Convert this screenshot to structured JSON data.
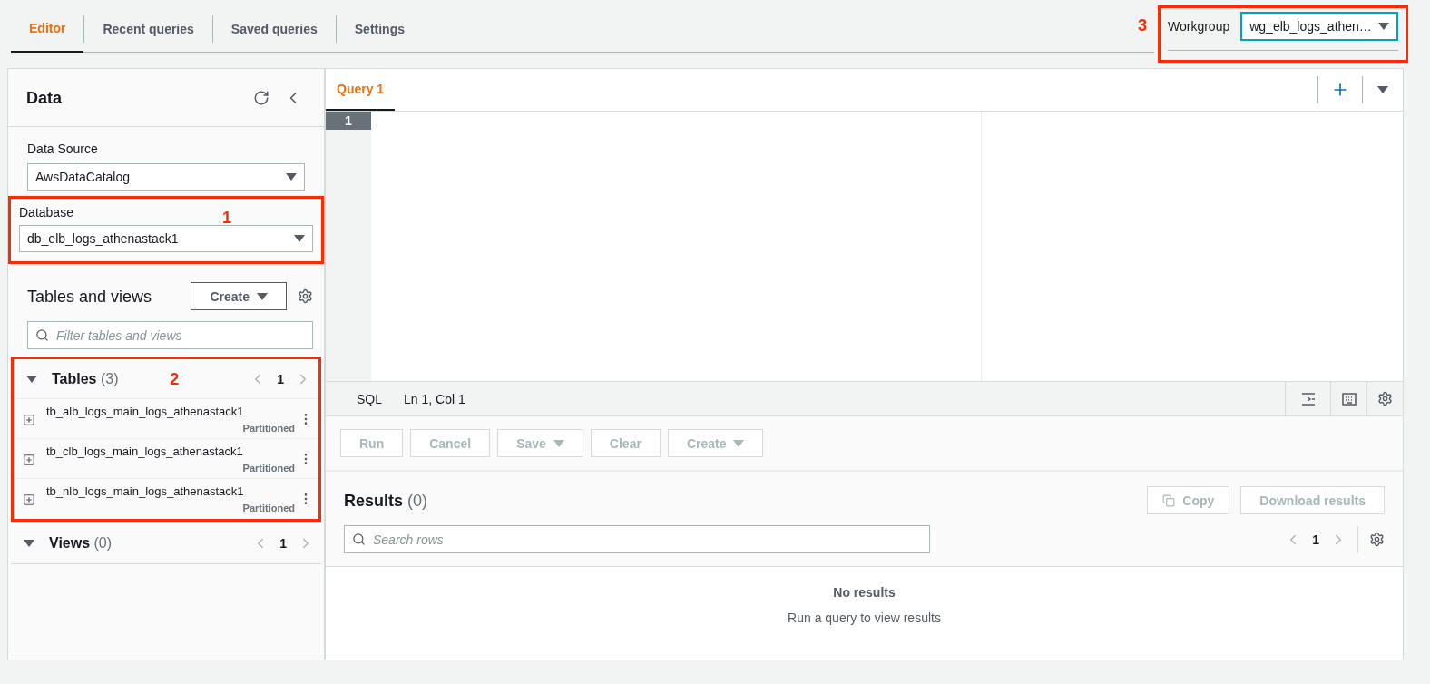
{
  "tabs": [
    {
      "label": "Editor",
      "selected": true
    },
    {
      "label": "Recent queries",
      "selected": false
    },
    {
      "label": "Saved queries",
      "selected": false
    },
    {
      "label": "Settings",
      "selected": false
    }
  ],
  "workgroup": {
    "label": "Workgroup",
    "value": "wg_elb_logs_athen…",
    "annotation": "3"
  },
  "data_panel": {
    "title": "Data",
    "data_source": {
      "label": "Data Source",
      "value": "AwsDataCatalog"
    },
    "database": {
      "label": "Database",
      "value": "db_elb_logs_athenastack1",
      "annotation": "1"
    },
    "tables_and_views": {
      "title": "Tables and views",
      "create_button": "Create",
      "filter_placeholder": "Filter tables and views"
    },
    "sections": [
      {
        "title": "Tables",
        "count": "(3)",
        "expanded": true,
        "page": "1",
        "annotation": "2",
        "items": [
          {
            "name": "tb_alb_logs_main_logs_athenastack1",
            "tag": "Partitioned"
          },
          {
            "name": "tb_clb_logs_main_logs_athenastack1",
            "tag": "Partitioned"
          },
          {
            "name": "tb_nlb_logs_main_logs_athenastack1",
            "tag": "Partitioned"
          }
        ]
      },
      {
        "title": "Views",
        "count": "(0)",
        "expanded": true,
        "page": "1"
      }
    ]
  },
  "editor": {
    "query_tabs": [
      {
        "label": "Query 1",
        "selected": true
      }
    ],
    "line_numbers": [
      "1"
    ],
    "status": {
      "language": "SQL",
      "position": "Ln 1, Col 1"
    },
    "actions": [
      {
        "label": "Run",
        "disabled": true,
        "dropdown": false
      },
      {
        "label": "Cancel",
        "disabled": true,
        "dropdown": false
      },
      {
        "label": "Save",
        "disabled": true,
        "dropdown": true
      },
      {
        "label": "Clear",
        "disabled": true,
        "dropdown": false
      },
      {
        "label": "Create",
        "disabled": true,
        "dropdown": true
      }
    ]
  },
  "results": {
    "title": "Results",
    "count": "(0)",
    "copy_button": {
      "label": "Copy",
      "disabled": true
    },
    "download_button": {
      "label": "Download results",
      "disabled": true
    },
    "search_placeholder": "Search rows",
    "page": "1",
    "empty_title": "No results",
    "empty_message": "Run a query to view results"
  }
}
